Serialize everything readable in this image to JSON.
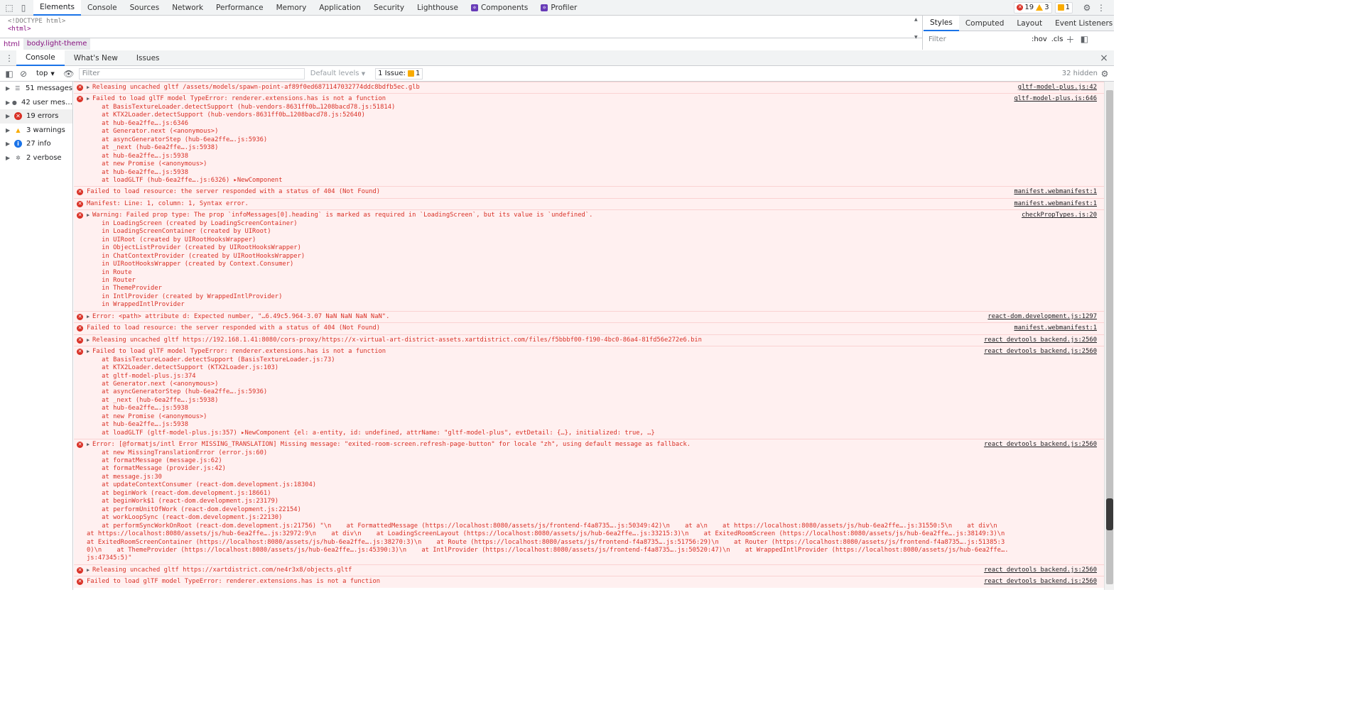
{
  "top_tabs": [
    {
      "label": "Elements",
      "active": true
    },
    {
      "label": "Console"
    },
    {
      "label": "Sources"
    },
    {
      "label": "Network"
    },
    {
      "label": "Performance"
    },
    {
      "label": "Memory"
    },
    {
      "label": "Application"
    },
    {
      "label": "Security"
    },
    {
      "label": "Lighthouse"
    },
    {
      "label": "Components"
    },
    {
      "label": "Profiler"
    }
  ],
  "status": {
    "errors": "19",
    "warnings": "3",
    "issues": "1"
  },
  "elements_panel": {
    "doctype": "<!DOCTYPE html>",
    "html_tag": "<html>",
    "crumb1": "html",
    "crumb2": "body.light-theme"
  },
  "styles_panel": {
    "tabs": [
      "Styles",
      "Computed",
      "Layout",
      "Event Listeners"
    ],
    "filter_placeholder": "Filter",
    "hov": ":hov",
    ".cls": ".cls"
  },
  "drawer_tabs": [
    "Console",
    "What's New",
    "Issues"
  ],
  "console_toolbar": {
    "context": "top",
    "filter_placeholder": "Filter",
    "levels": "Default levels",
    "issue_label": "1 Issue:",
    "issue_count": "1",
    "hidden": "32 hidden"
  },
  "sidebar": [
    {
      "label": "51 messages",
      "icon": "list-icon"
    },
    {
      "label": "42 user mes…",
      "icon": "user-icon"
    },
    {
      "label": "19 errors",
      "icon": "error-icon"
    },
    {
      "label": "3 warnings",
      "icon": "warning-icon"
    },
    {
      "label": "27 info",
      "icon": "info-icon"
    },
    {
      "label": "2 verbose",
      "icon": "verbose-icon"
    }
  ],
  "messages": [
    {
      "src": "gltf-model-plus.js:42",
      "lines": [
        "Releasing uncached gltf /assets/models/spawn-point-af89f0ed6871147032774ddc8bdfb5ec.glb"
      ]
    },
    {
      "src": "gltf-model-plus.js:646",
      "lines": [
        "Failed to load glTF model TypeError: renderer.extensions.has is not a function",
        "    at BasisTextureLoader.detectSupport (hub-vendors-8631ff0b…1208bacd78.js:51814)",
        "    at KTX2Loader.detectSupport (hub-vendors-8631ff0b…1208bacd78.js:52640)",
        "    at hub-6ea2ffe….js:6346",
        "    at Generator.next (<anonymous>)",
        "    at asyncGeneratorStep (hub-6ea2ffe….js:5936)",
        "    at _next (hub-6ea2ffe….js:5938)",
        "    at hub-6ea2ffe….js:5938",
        "    at new Promise (<anonymous>)",
        "    at hub-6ea2ffe….js:5938",
        "    at loadGLTF (hub-6ea2ffe….js:6326) ▸NewComponent"
      ]
    },
    {
      "src": "manifest.webmanifest:1",
      "lines": [
        "Failed to load resource: the server responded with a status of 404 (Not Found)"
      ]
    },
    {
      "src": "manifest.webmanifest:1",
      "lines": [
        "Manifest: Line: 1, column: 1, Syntax error."
      ]
    },
    {
      "src": "checkPropTypes.js:20",
      "lines": [
        "Warning: Failed prop type: The prop `infoMessages[0].heading` is marked as required in `LoadingScreen`, but its value is `undefined`.",
        "    in LoadingScreen (created by LoadingScreenContainer)",
        "    in LoadingScreenContainer (created by UIRoot)",
        "    in UIRoot (created by UIRootHooksWrapper)",
        "    in ObjectListProvider (created by UIRootHooksWrapper)",
        "    in ChatContextProvider (created by UIRootHooksWrapper)",
        "    in UIRootHooksWrapper (created by Context.Consumer)",
        "    in Route",
        "    in Router",
        "    in ThemeProvider",
        "    in IntlProvider (created by WrappedIntlProvider)",
        "    in WrappedIntlProvider"
      ]
    },
    {
      "src": "react-dom.development.js:1297",
      "lines": [
        "Error: <path> attribute d: Expected number, \"…6.49c5.964-3.07 NaN NaN NaN NaN\"."
      ]
    },
    {
      "src": "manifest.webmanifest:1",
      "lines": [
        "Failed to load resource: the server responded with a status of 404 (Not Found)"
      ]
    },
    {
      "src": "react_devtools_backend.js:2560",
      "lines": [
        "Releasing uncached gltf https://192.168.1.41:8080/cors-proxy/https://x-virtual-art-district-assets.xartdistrict.com/files/f5bbbf00-f190-4bc0-86a4-81fd56e272e6.bin"
      ]
    },
    {
      "src": "react_devtools_backend.js:2560",
      "lines": [
        "Failed to load glTF model TypeError: renderer.extensions.has is not a function",
        "    at BasisTextureLoader.detectSupport (BasisTextureLoader.js:73)",
        "    at KTX2Loader.detectSupport (KTX2Loader.js:103)",
        "    at gltf-model-plus.js:374",
        "    at Generator.next (<anonymous>)",
        "    at asyncGeneratorStep (hub-6ea2ffe….js:5936)",
        "    at _next (hub-6ea2ffe….js:5938)",
        "    at hub-6ea2ffe….js:5938",
        "    at new Promise (<anonymous>)",
        "    at hub-6ea2ffe….js:5938",
        "    at loadGLTF (gltf-model-plus.js:357) ▸NewComponent {el: a-entity, id: undefined, attrName: \"gltf-model-plus\", evtDetail: {…}, initialized: true, …}"
      ]
    },
    {
      "src": "react_devtools_backend.js:2560",
      "lines": [
        "Error: [@formatjs/intl Error MISSING_TRANSLATION] Missing message: \"exited-room-screen.refresh-page-button\" for locale \"zh\", using default message as fallback.",
        "",
        "    at new MissingTranslationError (error.js:60)",
        "    at formatMessage (message.js:62)",
        "    at formatMessage (provider.js:42)",
        "    at message.js:30",
        "    at updateContextConsumer (react-dom.development.js:18304)",
        "    at beginWork (react-dom.development.js:18661)",
        "    at beginWork$1 (react-dom.development.js:23179)",
        "    at performUnitOfWork (react-dom.development.js:22154)",
        "    at workLoopSync (react-dom.development.js:22130)"
      ],
      "wrap": "    at performSyncWorkOnRoot (react-dom.development.js:21756) \"\\n    at FormattedMessage (https://localhost:8080/assets/js/frontend-f4a8735….js:50349:42)\\n    at a\\n    at https://localhost:8080/assets/js/hub-6ea2ffe….js:31550:5\\n    at div\\n    at https://localhost:8080/assets/js/hub-6ea2ffe….js:32972:9\\n    at div\\n    at LoadingScreenLayout (https://localhost:8080/assets/js/hub-6ea2ffe….js:33215:3)\\n    at ExitedRoomScreen (https://localhost:8080/assets/js/hub-6ea2ffe….js:38149:3)\\n    at ExitedRoomScreenContainer (https://localhost:8080/assets/js/hub-6ea2ffe….js:38270:3)\\n    at Route (https://localhost:8080/assets/js/frontend-f4a8735….js:51756:29)\\n    at Router (https://localhost:8080/assets/js/frontend-f4a8735….js:51385:30)\\n    at ThemeProvider (https://localhost:8080/assets/js/hub-6ea2ffe….js:45390:3)\\n    at IntlProvider (https://localhost:8080/assets/js/frontend-f4a8735….js:50520:47)\\n    at WrappedIntlProvider (https://localhost:8080/assets/js/hub-6ea2ffe….js:47345:5)\""
    },
    {
      "src": "react_devtools_backend.js:2560",
      "lines": [
        "Releasing uncached gltf https://xartdistrict.com/ne4r3x8/objects.gltf"
      ]
    },
    {
      "src": "react_devtools_backend.js:2560",
      "lines": [
        "Failed to load glTF model TypeError: renderer.extensions.has is not a function"
      ]
    }
  ]
}
